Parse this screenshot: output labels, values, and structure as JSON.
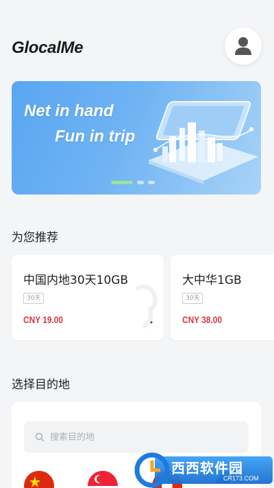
{
  "header": {
    "app_title": "GlocalMe",
    "avatar_icon": "user-icon"
  },
  "banner": {
    "line1": "Net in hand",
    "line2": "Fun in trip",
    "active_slide": 1,
    "slide_count": 3
  },
  "recommend": {
    "title": "为您推荐",
    "cards": [
      {
        "name": "中国内地30天10GB",
        "badge": "30天",
        "price": "CNY 19.00"
      },
      {
        "name": "大中华1GB",
        "badge": "30天",
        "price": "CNY 38.00"
      }
    ]
  },
  "destination": {
    "title": "选择目的地",
    "search_placeholder": "搜索目的地",
    "search_icon": "search-icon"
  },
  "watermark": {
    "brand": "西西软件园",
    "url": "CR173.COM"
  },
  "colors": {
    "page_bg": "#f4f5f7",
    "banner_blue": "#5aa6f2",
    "price_red": "#d9363e",
    "dot_active": "#9fe09a"
  }
}
